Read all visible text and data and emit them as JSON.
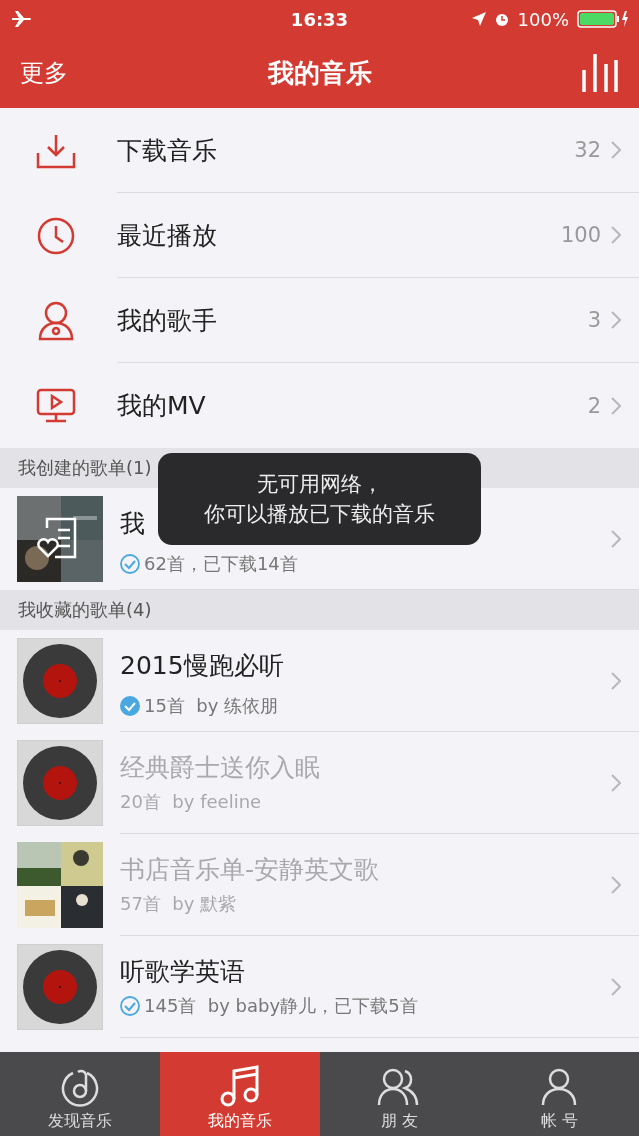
{
  "status_bar": {
    "time": "16:33",
    "battery": "100%"
  },
  "nav": {
    "left": "更多",
    "title": "我的音乐"
  },
  "menu": [
    {
      "kind": "download",
      "label": "下载音乐",
      "count": "32"
    },
    {
      "kind": "recent",
      "label": "最近播放",
      "count": "100"
    },
    {
      "kind": "artist",
      "label": "我的歌手",
      "count": "3"
    },
    {
      "kind": "mv",
      "label": "我的MV",
      "count": "2"
    }
  ],
  "sections": [
    {
      "title": "我创建的歌单(1)",
      "playlists": [
        {
          "kind": "liked",
          "title": "我",
          "subtitle": "62首，已下载14首",
          "check": {
            "kind": "outline"
          },
          "available": true
        }
      ]
    },
    {
      "title": "我收藏的歌单(4)",
      "playlists": [
        {
          "kind": "vinyl",
          "title": "2015慢跑必听",
          "subtitle": "15首  by 练依朋",
          "check": {
            "kind": "filled"
          },
          "available": true
        },
        {
          "kind": "vinyl",
          "title": "经典爵士送你入眠",
          "subtitle": "20首  by feeline",
          "available": false
        },
        {
          "kind": "picture",
          "title": "书店音乐单-安静英文歌",
          "subtitle": "57首  by 默紫",
          "available": false
        },
        {
          "kind": "vinyl",
          "title": "听歌学英语",
          "subtitle": "145首  by baby静儿，已下载5首",
          "check": {
            "kind": "outline"
          },
          "available": true
        }
      ]
    }
  ],
  "toast": {
    "lines": [
      "无可用网络，",
      "你可以播放已下载的音乐"
    ]
  },
  "tabs": [
    {
      "kind": "discover",
      "label": "发现音乐",
      "selected": false
    },
    {
      "kind": "music",
      "label": "我的音乐",
      "selected": true
    },
    {
      "kind": "friends",
      "label": "朋 友",
      "selected": false
    },
    {
      "kind": "account",
      "label": "帐 号",
      "selected": false
    }
  ]
}
